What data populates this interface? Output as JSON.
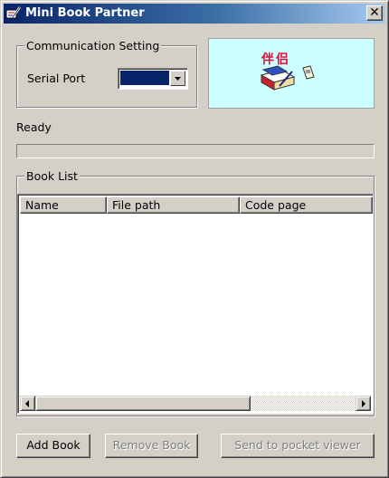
{
  "window": {
    "title": "Mini Book Partner",
    "close_glyph": "✕"
  },
  "communication": {
    "legend": "Communication Setting",
    "serial_port_label": "Serial Port",
    "serial_port_value": "",
    "logo_text": "伴侣"
  },
  "status": {
    "text": "Ready",
    "progress": 0
  },
  "book_list": {
    "legend": "Book List",
    "columns": [
      "Name",
      "File path",
      "Code page"
    ],
    "rows": []
  },
  "buttons": {
    "add_label": "Add Book",
    "remove_label": "Remove Book",
    "send_label": "Send to pocket viewer"
  },
  "colors": {
    "titlebar": "#0a246a",
    "face": "#d4d0c8",
    "logo_bg": "#ccffff",
    "selection": "#0a246a"
  },
  "icons": {
    "title": "book-pen-icon",
    "close": "close-icon",
    "dropdown": "chevron-down-icon",
    "scroll_left": "arrow-left-icon",
    "scroll_right": "arrow-right-icon",
    "logo": "books-device-icon"
  }
}
